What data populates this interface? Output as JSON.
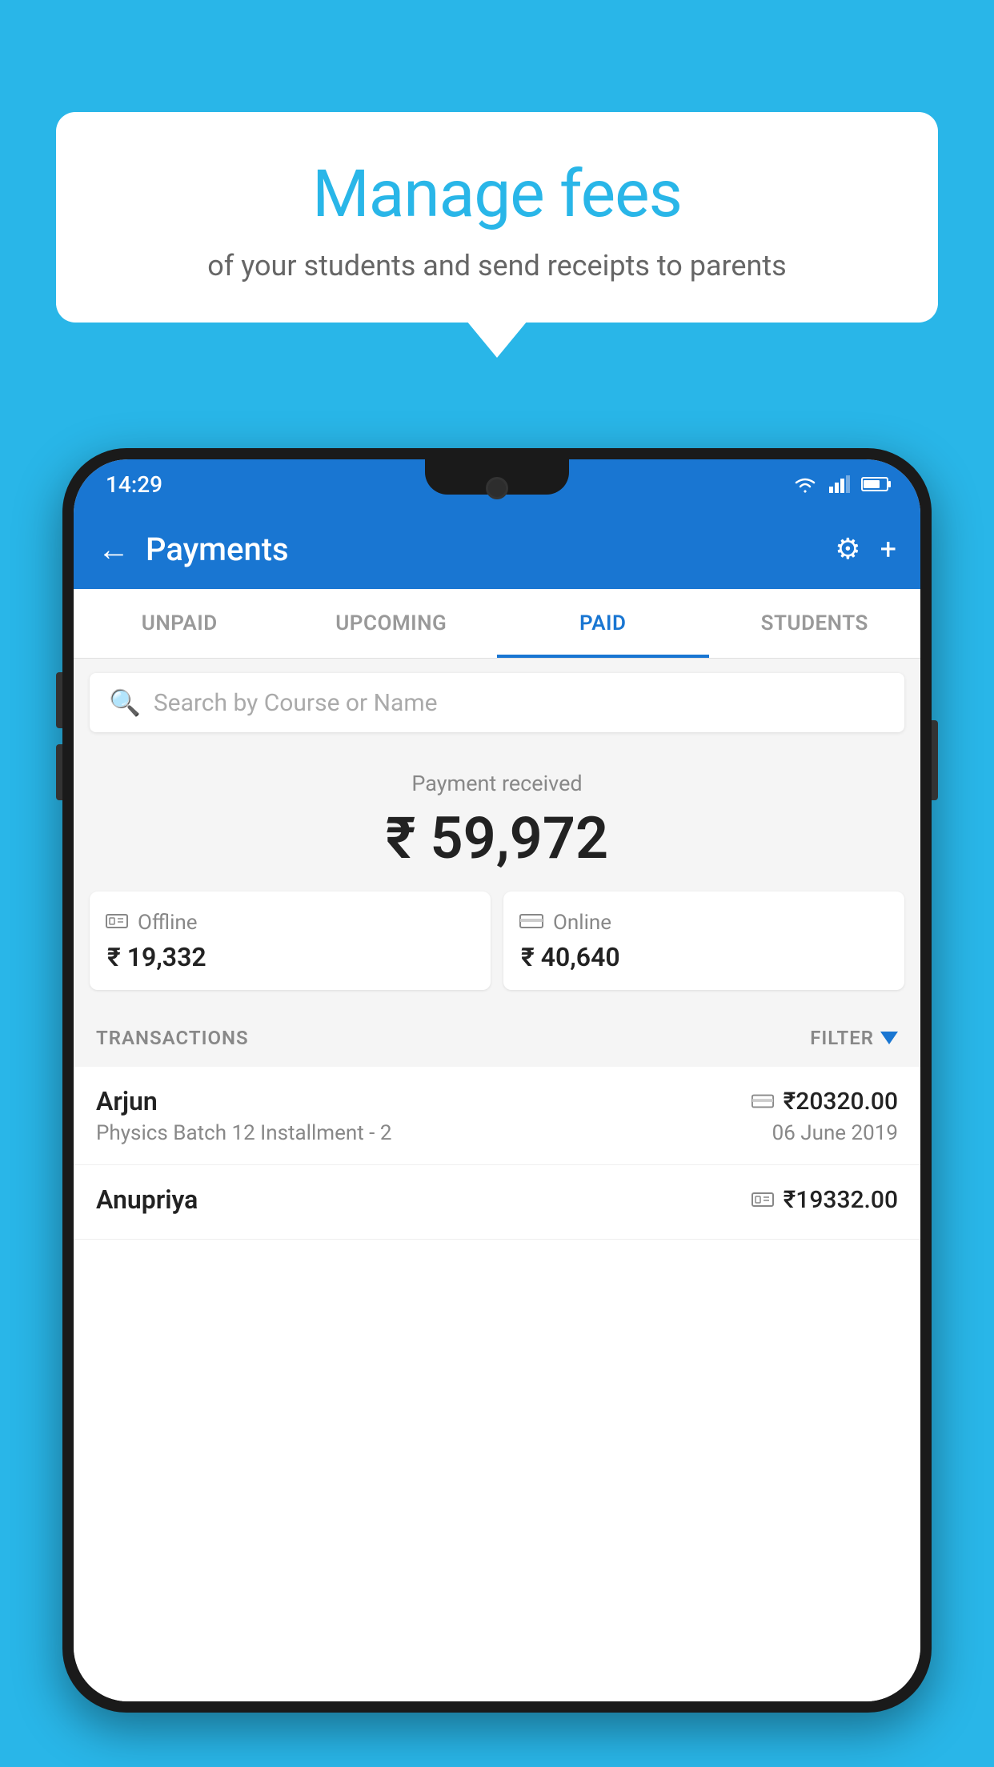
{
  "background_color": "#29b6e8",
  "speech_bubble": {
    "title": "Manage fees",
    "subtitle": "of your students and send receipts to parents"
  },
  "phone": {
    "status_bar": {
      "time": "14:29"
    },
    "app_bar": {
      "title": "Payments",
      "back_label": "←",
      "settings_label": "⚙",
      "add_label": "+"
    },
    "tabs": [
      {
        "label": "UNPAID",
        "active": false
      },
      {
        "label": "UPCOMING",
        "active": false
      },
      {
        "label": "PAID",
        "active": true
      },
      {
        "label": "STUDENTS",
        "active": false
      }
    ],
    "search": {
      "placeholder": "Search by Course or Name"
    },
    "payment_summary": {
      "label": "Payment received",
      "amount": "₹ 59,972",
      "offline": {
        "label": "Offline",
        "amount": "₹ 19,332"
      },
      "online": {
        "label": "Online",
        "amount": "₹ 40,640"
      }
    },
    "transactions": {
      "header_label": "TRANSACTIONS",
      "filter_label": "FILTER",
      "rows": [
        {
          "name": "Arjun",
          "course": "Physics Batch 12 Installment - 2",
          "amount": "₹20320.00",
          "date": "06 June 2019",
          "payment_type": "card"
        },
        {
          "name": "Anupriya",
          "course": "",
          "amount": "₹19332.00",
          "date": "",
          "payment_type": "cash"
        }
      ]
    }
  }
}
